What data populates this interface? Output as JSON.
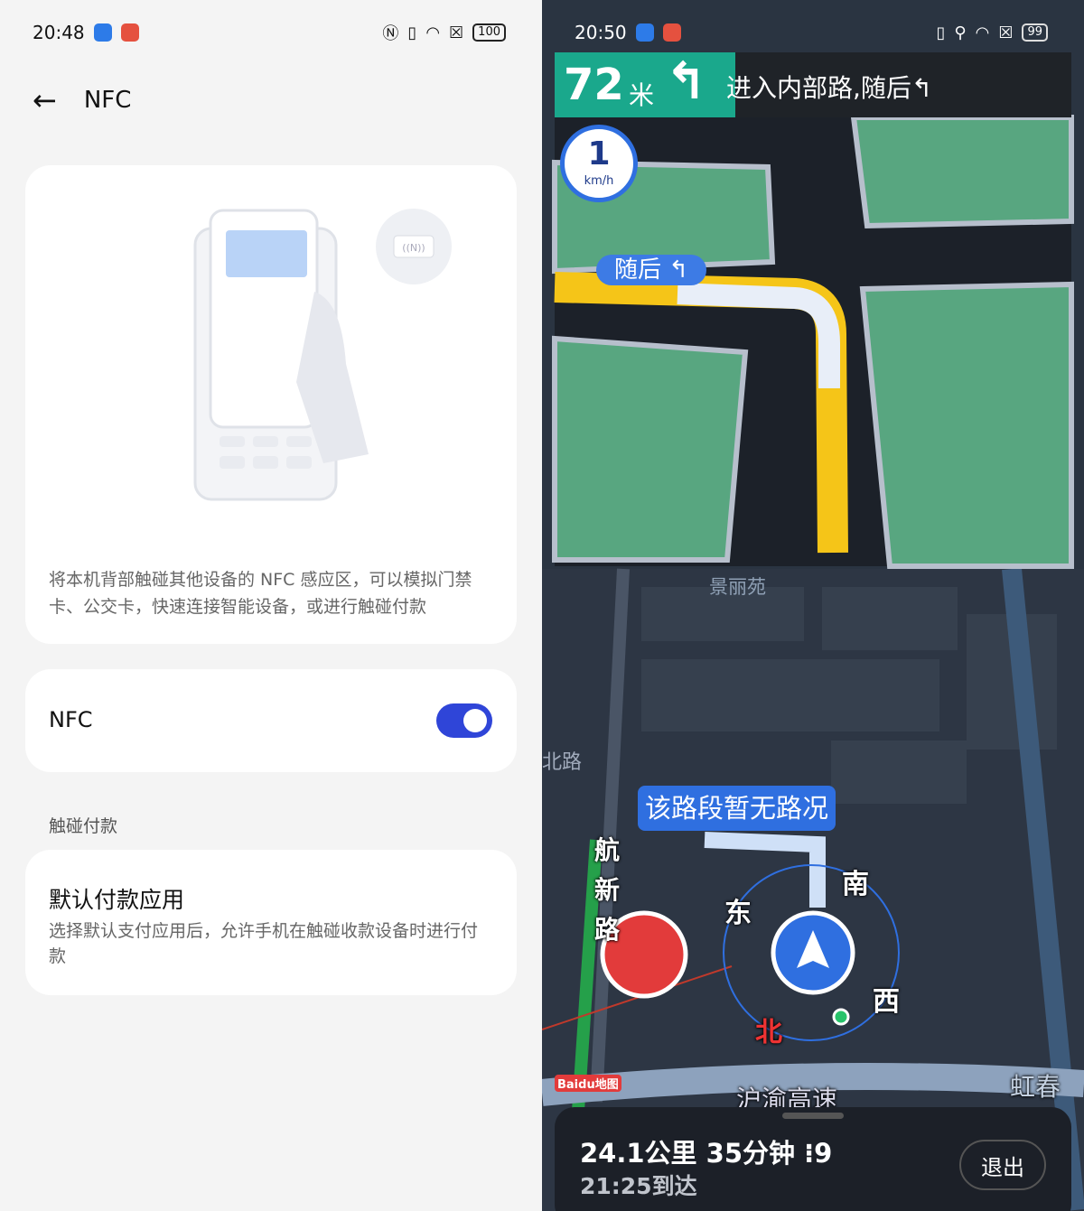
{
  "left": {
    "status": {
      "time": "20:48",
      "battery": "100",
      "icons": [
        "nfc-icon",
        "vibrate-icon",
        "wifi-icon",
        "sim-x-icon"
      ]
    },
    "header": {
      "title": "NFC"
    },
    "illustration": {
      "chip_label": "((N))"
    },
    "description": "将本机背部触碰其他设备的 NFC 感应区，可以模拟门禁卡、公交卡，快速连接智能设备，或进行触碰付款",
    "nfc_toggle": {
      "label": "NFC",
      "on": true,
      "color": "#2f45d8"
    },
    "section_title": "触碰付款",
    "default_payment": {
      "title": "默认付款应用",
      "subtitle": "选择默认支付应用后，允许手机在触碰收款设备时进行付款"
    }
  },
  "right": {
    "status": {
      "time": "20:50",
      "battery": "99"
    },
    "guide": {
      "distance": "72",
      "unit": "米",
      "instruction": "进入内部路,随后↰"
    },
    "speed": {
      "value": "1",
      "unit": "km/h"
    },
    "then_label": "随后 ↰",
    "traffic_bubble": "该路段暂无路况",
    "map_labels": {
      "poi": "景丽苑",
      "road1": "北路",
      "road2": "航新路",
      "road3": "沪渝高速",
      "road4": "虹春路"
    },
    "compass": {
      "e": "东",
      "s": "南",
      "w": "西",
      "n": "北"
    },
    "logo": "Baidu地图",
    "trip": {
      "summary": "24.1公里 35分钟",
      "lights": "9",
      "arrival": "21:25到达",
      "exit": "退出"
    }
  }
}
